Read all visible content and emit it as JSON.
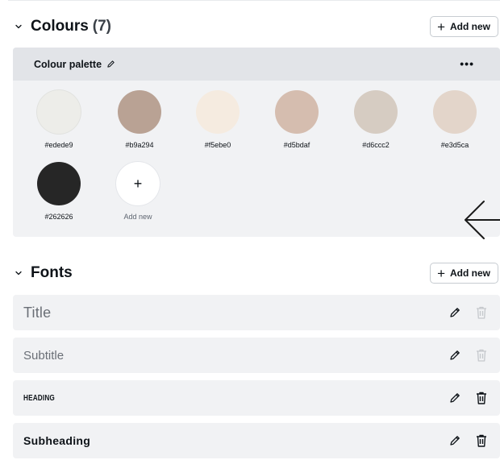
{
  "colours": {
    "title": "Colours",
    "count": "(7)",
    "add_label": "Add new",
    "palette": {
      "name": "Colour palette",
      "menu": "•••",
      "swatches": [
        {
          "hex": "#edede9"
        },
        {
          "hex": "#b9a294"
        },
        {
          "hex": "#f5ebe0"
        },
        {
          "hex": "#d5bdaf"
        },
        {
          "hex": "#d6ccc2"
        },
        {
          "hex": "#e3d5ca"
        },
        {
          "hex": "#262626"
        }
      ],
      "add_swatch_label": "Add new",
      "add_swatch_symbol": "+"
    }
  },
  "fonts": {
    "title": "Fonts",
    "add_label": "Add new",
    "items": [
      {
        "label": "Title",
        "trash_enabled": false
      },
      {
        "label": "Subtitle",
        "trash_enabled": false
      },
      {
        "label": "HEADING",
        "trash_enabled": true
      },
      {
        "label": "Subheading",
        "trash_enabled": true
      }
    ]
  },
  "icons": {
    "chevron": "chevron-down-icon",
    "plus": "plus-icon",
    "pencil": "pencil-icon",
    "trash": "trash-icon",
    "more": "more-icon",
    "arrow": "arrow-left-icon"
  },
  "colors": {
    "panel": "#f1f2f4",
    "palette_header": "#e2e4e8",
    "text": "#0e1318",
    "muted": "#6a6f76"
  }
}
